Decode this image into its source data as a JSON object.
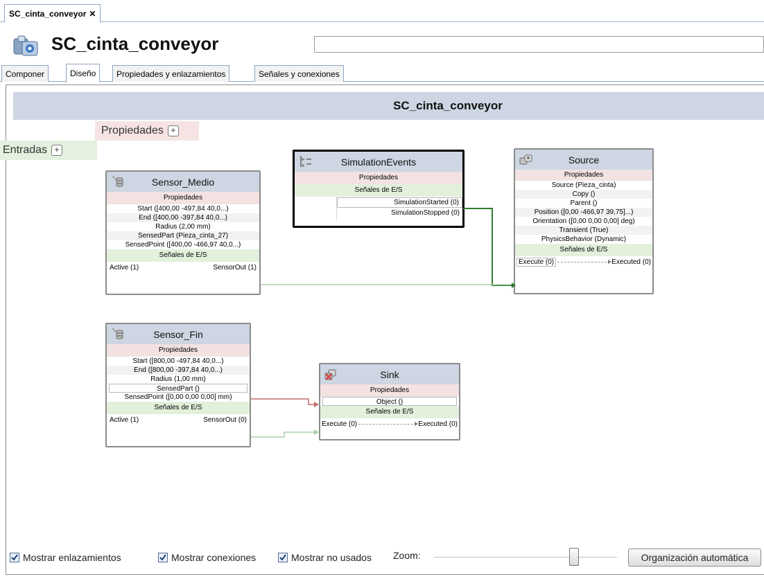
{
  "doc_tab": {
    "label": "SC_cinta_conveyor",
    "close": "✕"
  },
  "header": {
    "title": "SC_cinta_conveyor",
    "field_value": ""
  },
  "tabs": [
    {
      "label": "Componer"
    },
    {
      "label": "Diseño"
    },
    {
      "label": "Propiedades y enlazamientos"
    },
    {
      "label": "Señales y conexiones"
    }
  ],
  "active_tab": "Diseño",
  "canvas": {
    "title": "SC_cinta_conveyor",
    "properties_label": "Propiedades",
    "inputs_label": "Entradas",
    "plus": "+"
  },
  "components": {
    "sensor_medio": {
      "title": "Sensor_Medio",
      "properties_header": "Propiedades",
      "properties": [
        "Start ([400,00 -497,84 40,0...)",
        "End ([400,00 -397,84 40,0...)",
        "Radius (2,00 mm)",
        "SensedPart (Pieza_cinta_27)",
        "SensedPoint ([400,00 -466,97 40,0...)"
      ],
      "signals_header": "Señales de E/S",
      "input_signal": "Active (1)",
      "output_signal": "SensorOut (1)"
    },
    "sensor_fin": {
      "title": "Sensor_Fin",
      "properties_header": "Propiedades",
      "properties": [
        "Start ([800,00 -497,84 40,0...)",
        "End ([800,00 -397,84 40,0...)",
        "Radius (1,00 mm)",
        "SensedPart ()",
        "SensedPoint ([0,00 0,00 0,00] mm)"
      ],
      "signals_header": "Señales de E/S",
      "input_signal": "Active (1)",
      "output_signal": "SensorOut (0)"
    },
    "simulation_events": {
      "title": "SimulationEvents",
      "properties_header": "Propiedades",
      "signals_header": "Señales de E/S",
      "outputs": [
        "SimulationStarted (0)",
        "SimulationStopped (0)"
      ]
    },
    "source": {
      "title": "Source",
      "properties_header": "Propiedades",
      "properties": [
        "Source (Pieza_cinta)",
        "Copy ()",
        "Parent ()",
        "Position ([0,00 -466,97 39,75]...)",
        "Orientation ([0,00 0,00 0,00] deg)",
        "Transient (True)",
        "PhysicsBehavior (Dynamic)"
      ],
      "signals_header": "Señales de E/S",
      "input_signal": "Execute (0)",
      "output_signal": "Executed (0)"
    },
    "sink": {
      "title": "Sink",
      "properties_header": "Propiedades",
      "properties": [
        "Object ()"
      ],
      "signals_header": "Señales de E/S",
      "input_signal": "Execute (0)",
      "output_signal": "Executed (0)"
    }
  },
  "bottom": {
    "show_links": {
      "label": "Mostrar enlazamientos",
      "checked": true
    },
    "show_connections": {
      "label": "Mostrar conexiones",
      "checked": true
    },
    "show_unused": {
      "label": "Mostrar no usados",
      "checked": true
    },
    "zoom_label": "Zoom:",
    "auto_layout_button": "Organización automática"
  },
  "colors": {
    "header_band": "#cdd6e2",
    "properties_band": "#f3e2e2",
    "signals_band": "#e2f0dc",
    "active_connection": "#2e7d2e",
    "inactive_connection": "#a8cfa8",
    "binding_link": "#c46a6a"
  }
}
